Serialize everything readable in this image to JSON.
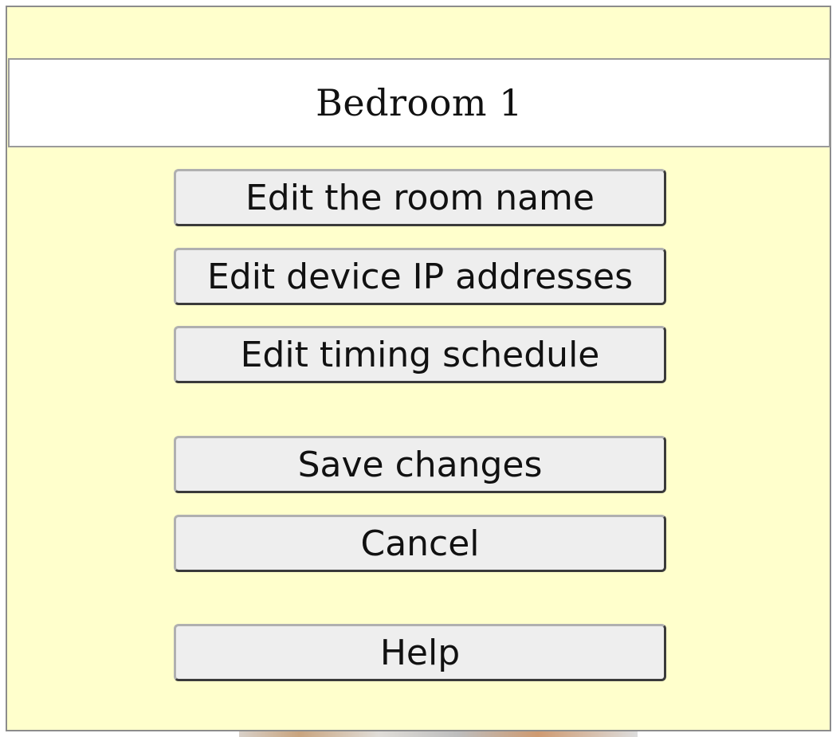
{
  "room": {
    "title": "Bedroom 1"
  },
  "buttons": {
    "edit_name": "Edit the room name",
    "edit_ip": "Edit device IP addresses",
    "edit_schedule": "Edit timing schedule",
    "save": "Save changes",
    "cancel": "Cancel",
    "help": "Help"
  },
  "colors": {
    "dialog_background": "#ffffcc",
    "button_face": "#eeeeee",
    "title_background": "#ffffff"
  }
}
